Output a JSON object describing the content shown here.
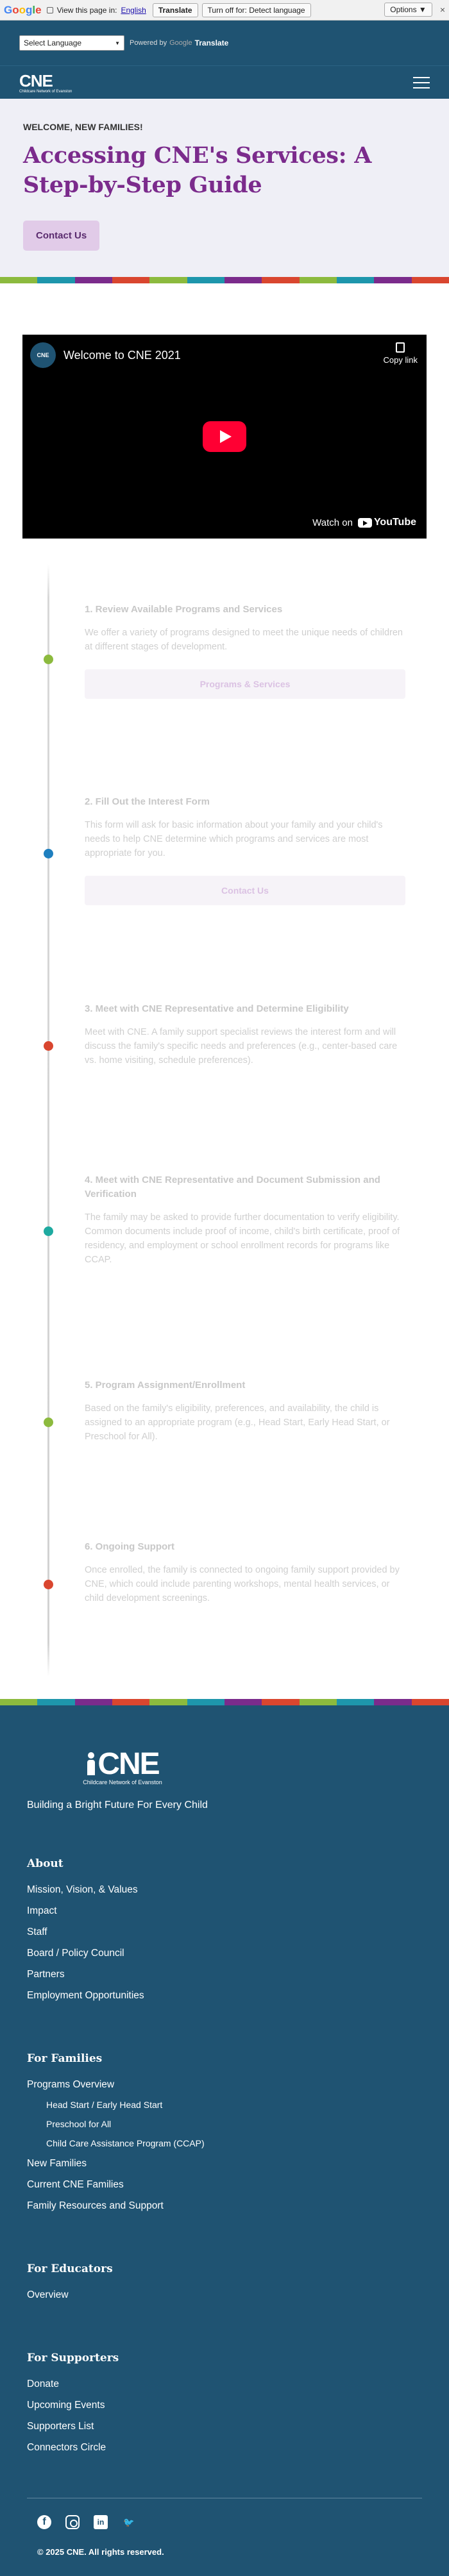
{
  "translate_bar": {
    "logo": "Google",
    "prompt": "View this page in:",
    "language": "English",
    "translate_btn": "Translate",
    "turn_off_btn": "Turn off for: Detect language",
    "options_btn": "Options ▼",
    "close": "×"
  },
  "language_row": {
    "select_label": "Select Language",
    "select_arrow": "▼",
    "powered_by": "Powered by",
    "google": "Google",
    "translate": "Translate"
  },
  "header": {
    "logo_text": "CNE",
    "logo_sub": "Childcare Network of Evanston",
    "menu_icon": "hamburger-icon"
  },
  "hero": {
    "welcome": "WELCOME, NEW FAMILIES!",
    "title": "Accessing CNE's Services: A Step-by-Step Guide",
    "button": "Contact Us"
  },
  "colors": {
    "brand_blue": "#1f5372",
    "brand_purple": "#7b2b8c",
    "stripe": [
      "#8cba3e",
      "#1e96ac",
      "#7b2b8c",
      "#d9462f",
      "#8cba3e",
      "#1e96ac",
      "#7b2b8c",
      "#d9462f",
      "#8cba3e",
      "#1e96ac",
      "#7b2b8c",
      "#d9462f"
    ]
  },
  "video": {
    "channel": "CNE",
    "title": "Welcome to CNE 2021",
    "copy_link": "Copy link",
    "watch_on": "Watch on",
    "youtube": "YouTube"
  },
  "steps": [
    {
      "title": "1. Review Available Programs and Services",
      "body": "We offer a variety of programs designed to meet the unique needs of children at different stages of development.",
      "button": "Programs & Services",
      "dot_color": "#8cba3e"
    },
    {
      "title": "2. Fill Out the Interest Form",
      "body": "This form will ask for basic information about your family and your child's needs to help CNE determine which programs and services are most appropriate for you.",
      "button": "Contact Us",
      "dot_color": "#1e7fbf"
    },
    {
      "title": "3. Meet with CNE Representative and Determine Eligibility",
      "body": "Meet with CNE. A family support specialist reviews the interest form and will discuss the family's specific needs and preferences (e.g., center-based care vs. home visiting, schedule preferences).",
      "dot_color": "#d9462f"
    },
    {
      "title": "4. Meet with CNE Representative and Document Submission and Verification",
      "body": "The family may be asked to provide further documentation to verify eligibility. Common documents include proof of income, child's birth certificate, proof of residency, and employment or school enrollment records for programs like CCAP.",
      "dot_color": "#1eaaa0"
    },
    {
      "title": "5. Program Assignment/Enrollment",
      "body": "Based on the family's eligibility, preferences, and availability, the child is assigned to an appropriate program (e.g., Head Start, Early Head Start, or Preschool for All).",
      "dot_color": "#8cba3e"
    },
    {
      "title": "6. Ongoing Support",
      "body": "Once enrolled, the family is connected to ongoing family support provided by CNE, which could include parenting workshops, mental health services, or child development screenings.",
      "dot_color": "#d9462f"
    }
  ],
  "footer": {
    "logo_text": "CNE",
    "logo_sub": "Childcare Network of Evanston",
    "tagline": "Building a Bright Future For Every Child",
    "about_heading": "About",
    "about_items": [
      "Mission, Vision, & Values",
      "Impact",
      "Staff",
      "Board / Policy Council",
      "Partners",
      "Employment Opportunities"
    ],
    "families_heading": "For Families",
    "families_overview": "Programs Overview",
    "families_sub": [
      "Head Start / Early Head Start",
      "Preschool for All",
      "Child Care Assistance Program (CCAP)"
    ],
    "families_items": [
      "New Families",
      "Current CNE Families",
      "Family Resources and Support"
    ],
    "educators_heading": "For Educators",
    "educators_items": [
      "Overview"
    ],
    "supporters_heading": "For Supporters",
    "supporters_items": [
      "Donate",
      "Upcoming Events",
      "Supporters List",
      "Connectors Circle"
    ],
    "social": {
      "facebook": "f",
      "instagram": "",
      "linkedin": "in",
      "twitter": "🐦"
    },
    "copyright": "© 2025 CNE. All rights reserved."
  }
}
